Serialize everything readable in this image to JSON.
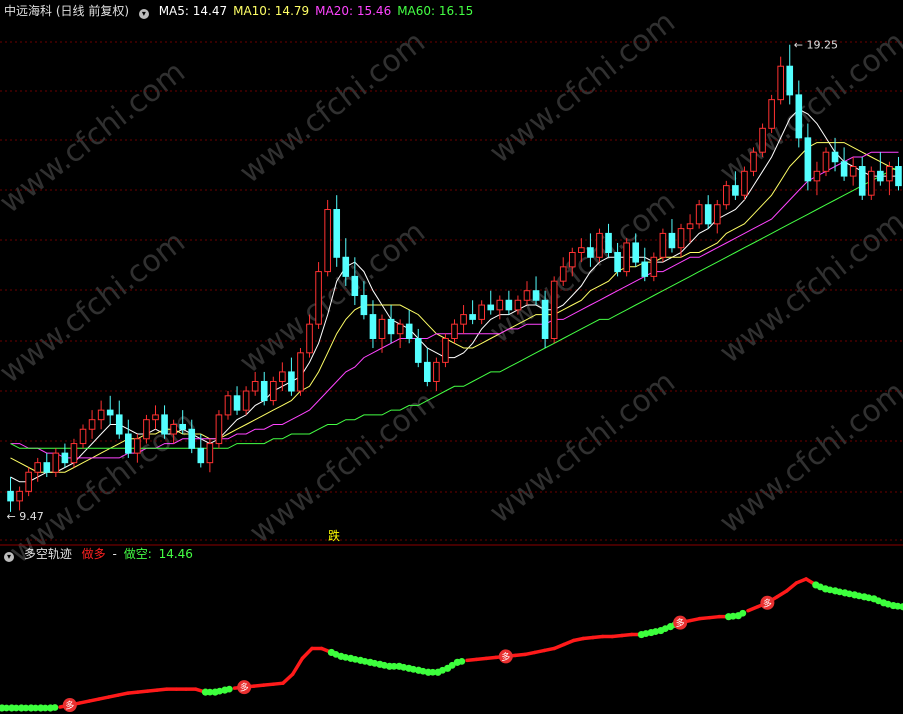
{
  "header": {
    "stock": "中远海科",
    "period": "(日线 前复权)",
    "ma": [
      {
        "label": "MA5",
        "value": "14.47",
        "color": "#ffffff"
      },
      {
        "label": "MA10",
        "value": "14.79",
        "color": "#ffff66"
      },
      {
        "label": "MA20",
        "value": "15.46",
        "color": "#ff44ff"
      },
      {
        "label": "MA60",
        "value": "16.15",
        "color": "#44ff44"
      }
    ]
  },
  "indicator": {
    "name": "多空轨迹",
    "long_label": "做多",
    "sep": "-",
    "short_label": "做空",
    "value": "14.46"
  },
  "watermark": "www.cfchi.com",
  "chart_data": [
    {
      "type": "candlestick",
      "panel": "price",
      "title": "中远海科 (日线 前复权)",
      "high_label": "19.25",
      "low_label": "9.47",
      "marker_label": "跌",
      "ylim": [
        9.3,
        19.6
      ],
      "ohlc": [
        [
          9.9,
          10.2,
          9.47,
          9.7
        ],
        [
          9.7,
          10.0,
          9.5,
          9.9
        ],
        [
          9.9,
          10.4,
          9.8,
          10.3
        ],
        [
          10.3,
          10.6,
          10.1,
          10.5
        ],
        [
          10.5,
          10.7,
          10.2,
          10.3
        ],
        [
          10.3,
          10.8,
          10.2,
          10.7
        ],
        [
          10.7,
          10.9,
          10.4,
          10.5
        ],
        [
          10.5,
          11.0,
          10.4,
          10.9
        ],
        [
          10.9,
          11.3,
          10.8,
          11.2
        ],
        [
          11.2,
          11.6,
          11.0,
          11.4
        ],
        [
          11.4,
          11.8,
          11.2,
          11.6
        ],
        [
          11.6,
          11.9,
          11.3,
          11.5
        ],
        [
          11.5,
          11.8,
          11.0,
          11.1
        ],
        [
          11.1,
          11.4,
          10.6,
          10.7
        ],
        [
          10.7,
          11.1,
          10.5,
          11.0
        ],
        [
          11.0,
          11.5,
          10.9,
          11.4
        ],
        [
          11.4,
          11.7,
          11.2,
          11.5
        ],
        [
          11.5,
          11.7,
          11.0,
          11.1
        ],
        [
          11.1,
          11.4,
          10.9,
          11.3
        ],
        [
          11.3,
          11.6,
          11.1,
          11.2
        ],
        [
          11.2,
          11.4,
          10.7,
          10.8
        ],
        [
          10.8,
          11.1,
          10.4,
          10.5
        ],
        [
          10.5,
          11.0,
          10.3,
          10.9
        ],
        [
          10.9,
          11.6,
          10.8,
          11.5
        ],
        [
          11.5,
          12.0,
          11.4,
          11.9
        ],
        [
          11.9,
          12.1,
          11.5,
          11.6
        ],
        [
          11.6,
          12.1,
          11.5,
          12.0
        ],
        [
          12.0,
          12.4,
          11.9,
          12.2
        ],
        [
          12.2,
          12.4,
          11.7,
          11.8
        ],
        [
          11.8,
          12.3,
          11.7,
          12.2
        ],
        [
          12.2,
          12.6,
          12.0,
          12.4
        ],
        [
          12.4,
          12.7,
          11.9,
          12.0
        ],
        [
          12.0,
          12.9,
          11.9,
          12.8
        ],
        [
          12.8,
          13.6,
          12.7,
          13.4
        ],
        [
          13.4,
          14.7,
          13.3,
          14.5
        ],
        [
          14.5,
          16.0,
          14.4,
          15.8
        ],
        [
          15.8,
          16.1,
          14.6,
          14.8
        ],
        [
          14.8,
          15.2,
          14.2,
          14.4
        ],
        [
          14.4,
          14.8,
          13.8,
          14.0
        ],
        [
          14.0,
          14.3,
          13.5,
          13.6
        ],
        [
          13.6,
          13.9,
          12.9,
          13.1
        ],
        [
          13.1,
          13.6,
          12.8,
          13.5
        ],
        [
          13.5,
          13.8,
          13.0,
          13.2
        ],
        [
          13.2,
          13.5,
          12.9,
          13.4
        ],
        [
          13.4,
          13.7,
          13.0,
          13.1
        ],
        [
          13.1,
          13.3,
          12.5,
          12.6
        ],
        [
          12.6,
          12.9,
          12.1,
          12.2
        ],
        [
          12.2,
          12.7,
          12.0,
          12.6
        ],
        [
          12.6,
          13.2,
          12.5,
          13.1
        ],
        [
          13.1,
          13.5,
          13.0,
          13.4
        ],
        [
          13.4,
          13.8,
          13.2,
          13.6
        ],
        [
          13.6,
          13.9,
          13.4,
          13.5
        ],
        [
          13.5,
          13.9,
          13.4,
          13.8
        ],
        [
          13.8,
          14.1,
          13.6,
          13.7
        ],
        [
          13.7,
          14.0,
          13.5,
          13.9
        ],
        [
          13.9,
          14.1,
          13.6,
          13.7
        ],
        [
          13.7,
          14.0,
          13.6,
          13.9
        ],
        [
          13.9,
          14.3,
          13.8,
          14.1
        ],
        [
          14.1,
          14.4,
          13.8,
          13.9
        ],
        [
          13.9,
          14.1,
          12.9,
          13.1
        ],
        [
          13.1,
          14.4,
          13.0,
          14.3
        ],
        [
          14.3,
          14.8,
          14.2,
          14.6
        ],
        [
          14.6,
          15.0,
          14.4,
          14.9
        ],
        [
          14.9,
          15.2,
          14.7,
          15.0
        ],
        [
          15.0,
          15.3,
          14.6,
          14.8
        ],
        [
          14.8,
          15.4,
          14.7,
          15.3
        ],
        [
          15.3,
          15.5,
          14.8,
          14.9
        ],
        [
          14.9,
          15.1,
          14.4,
          14.5
        ],
        [
          14.5,
          15.2,
          14.4,
          15.1
        ],
        [
          15.1,
          15.3,
          14.6,
          14.7
        ],
        [
          14.7,
          15.0,
          14.3,
          14.4
        ],
        [
          14.4,
          14.9,
          14.3,
          14.8
        ],
        [
          14.8,
          15.4,
          14.7,
          15.3
        ],
        [
          15.3,
          15.6,
          14.9,
          15.0
        ],
        [
          15.0,
          15.5,
          14.8,
          15.4
        ],
        [
          15.4,
          15.7,
          15.1,
          15.5
        ],
        [
          15.5,
          16.0,
          15.4,
          15.9
        ],
        [
          15.9,
          16.1,
          15.4,
          15.5
        ],
        [
          15.5,
          16.0,
          15.3,
          15.9
        ],
        [
          15.9,
          16.4,
          15.8,
          16.3
        ],
        [
          16.3,
          16.6,
          16.0,
          16.1
        ],
        [
          16.1,
          16.7,
          16.0,
          16.6
        ],
        [
          16.6,
          17.1,
          16.5,
          17.0
        ],
        [
          17.0,
          17.6,
          16.9,
          17.5
        ],
        [
          17.5,
          18.2,
          17.4,
          18.1
        ],
        [
          18.1,
          19.0,
          18.0,
          18.8
        ],
        [
          18.8,
          19.25,
          18.0,
          18.2
        ],
        [
          18.2,
          18.5,
          17.1,
          17.3
        ],
        [
          17.3,
          17.6,
          16.2,
          16.4
        ],
        [
          16.4,
          16.8,
          16.1,
          16.6
        ],
        [
          16.6,
          17.1,
          16.5,
          17.0
        ],
        [
          17.0,
          17.3,
          16.6,
          16.8
        ],
        [
          16.8,
          17.1,
          16.4,
          16.5
        ],
        [
          16.5,
          16.9,
          16.3,
          16.7
        ],
        [
          16.7,
          16.9,
          16.0,
          16.1
        ],
        [
          16.1,
          16.7,
          16.0,
          16.6
        ],
        [
          16.6,
          17.0,
          16.3,
          16.4
        ],
        [
          16.4,
          16.8,
          16.1,
          16.7
        ],
        [
          16.7,
          16.9,
          16.2,
          16.3
        ]
      ],
      "series": [
        {
          "name": "MA5",
          "values": [
            10.2,
            10.1,
            10.1,
            10.2,
            10.3,
            10.3,
            10.4,
            10.5,
            10.7,
            10.9,
            11.1,
            11.3,
            11.3,
            11.2,
            11.1,
            11.1,
            11.2,
            11.1,
            11.1,
            11.2,
            11.1,
            11.0,
            10.9,
            11.0,
            11.2,
            11.4,
            11.5,
            11.7,
            11.8,
            12.0,
            12.1,
            12.2,
            12.3,
            12.6,
            13.0,
            13.6,
            14.3,
            14.6,
            14.7,
            14.5,
            14.1,
            13.8,
            13.5,
            13.4,
            13.3,
            13.1,
            12.9,
            12.8,
            12.7,
            12.7,
            12.8,
            13.0,
            13.3,
            13.5,
            13.6,
            13.6,
            13.7,
            13.8,
            13.8,
            13.7,
            13.7,
            13.8,
            14.0,
            14.2,
            14.5,
            14.7,
            14.8,
            14.8,
            14.8,
            14.8,
            14.8,
            14.7,
            14.7,
            14.8,
            14.9,
            15.1,
            15.3,
            15.4,
            15.6,
            15.7,
            15.8,
            16.0,
            16.3,
            16.6,
            16.9,
            17.3,
            17.7,
            17.9,
            17.8,
            17.6,
            17.3,
            17.0,
            16.8,
            16.7,
            16.6,
            16.5,
            16.5,
            16.5,
            16.5
          ]
        },
        {
          "name": "MA10",
          "values": [
            10.6,
            10.5,
            10.4,
            10.3,
            10.3,
            10.3,
            10.3,
            10.4,
            10.5,
            10.6,
            10.7,
            10.8,
            10.9,
            11.0,
            11.0,
            11.1,
            11.1,
            11.2,
            11.2,
            11.1,
            11.1,
            11.1,
            11.0,
            11.0,
            11.1,
            11.2,
            11.3,
            11.4,
            11.5,
            11.6,
            11.7,
            11.8,
            12.0,
            12.1,
            12.4,
            12.8,
            13.2,
            13.5,
            13.7,
            13.8,
            13.8,
            13.8,
            13.8,
            13.8,
            13.7,
            13.6,
            13.4,
            13.2,
            13.1,
            13.0,
            12.9,
            12.9,
            13.0,
            13.1,
            13.2,
            13.3,
            13.4,
            13.5,
            13.6,
            13.6,
            13.6,
            13.7,
            13.8,
            13.9,
            14.1,
            14.2,
            14.3,
            14.5,
            14.6,
            14.6,
            14.7,
            14.7,
            14.8,
            14.8,
            14.8,
            14.9,
            14.9,
            15.0,
            15.1,
            15.3,
            15.4,
            15.5,
            15.7,
            15.9,
            16.1,
            16.4,
            16.7,
            16.9,
            17.1,
            17.2,
            17.2,
            17.2,
            17.2,
            17.1,
            17.0,
            16.9,
            16.8,
            16.7,
            16.6
          ]
        },
        {
          "name": "MA20",
          "values": [
            10.9,
            10.9,
            10.8,
            10.8,
            10.7,
            10.7,
            10.6,
            10.6,
            10.6,
            10.6,
            10.6,
            10.6,
            10.6,
            10.7,
            10.7,
            10.8,
            10.8,
            10.9,
            10.9,
            11.0,
            11.0,
            11.0,
            11.0,
            11.0,
            11.0,
            11.1,
            11.1,
            11.2,
            11.2,
            11.3,
            11.3,
            11.4,
            11.5,
            11.6,
            11.8,
            12.0,
            12.2,
            12.4,
            12.5,
            12.7,
            12.8,
            12.9,
            13.0,
            13.1,
            13.1,
            13.1,
            13.1,
            13.2,
            13.2,
            13.2,
            13.2,
            13.2,
            13.2,
            13.2,
            13.2,
            13.3,
            13.3,
            13.4,
            13.4,
            13.4,
            13.5,
            13.5,
            13.6,
            13.7,
            13.8,
            13.9,
            14.0,
            14.1,
            14.2,
            14.3,
            14.4,
            14.5,
            14.5,
            14.6,
            14.7,
            14.8,
            14.8,
            14.9,
            15.0,
            15.1,
            15.2,
            15.3,
            15.4,
            15.5,
            15.6,
            15.8,
            16.0,
            16.2,
            16.4,
            16.5,
            16.6,
            16.7,
            16.8,
            16.9,
            16.9,
            17.0,
            17.0,
            17.0,
            17.0
          ]
        },
        {
          "name": "MA60",
          "values": [
            10.9,
            10.8,
            10.8,
            10.8,
            10.8,
            10.8,
            10.8,
            10.8,
            10.8,
            10.8,
            10.8,
            10.8,
            10.8,
            10.8,
            10.8,
            10.8,
            10.8,
            10.8,
            10.8,
            10.8,
            10.8,
            10.8,
            10.8,
            10.8,
            10.8,
            10.9,
            10.9,
            10.9,
            10.9,
            11.0,
            11.0,
            11.1,
            11.1,
            11.1,
            11.2,
            11.3,
            11.3,
            11.4,
            11.4,
            11.5,
            11.5,
            11.5,
            11.6,
            11.6,
            11.7,
            11.7,
            11.8,
            11.9,
            12.0,
            12.1,
            12.1,
            12.2,
            12.3,
            12.4,
            12.4,
            12.5,
            12.6,
            12.7,
            12.8,
            12.9,
            13.0,
            13.1,
            13.2,
            13.3,
            13.4,
            13.5,
            13.5,
            13.6,
            13.7,
            13.8,
            13.9,
            14.0,
            14.1,
            14.2,
            14.3,
            14.4,
            14.5,
            14.6,
            14.7,
            14.8,
            14.9,
            15.0,
            15.1,
            15.2,
            15.3,
            15.4,
            15.5,
            15.6,
            15.7,
            15.8,
            15.9,
            16.0,
            16.1,
            16.2,
            16.3,
            16.4,
            16.5,
            16.6,
            16.7
          ]
        }
      ]
    },
    {
      "type": "line",
      "panel": "indicator",
      "name": "多空轨迹",
      "long_marker": "多",
      "ylim": [
        9.3,
        19.6
      ],
      "values": [
        9.3,
        9.3,
        9.3,
        9.3,
        9.3,
        9.3,
        9.35,
        9.45,
        9.55,
        9.65,
        9.75,
        9.85,
        9.95,
        10.05,
        10.1,
        10.15,
        10.2,
        10.25,
        10.25,
        10.25,
        10.25,
        10.1,
        10.1,
        10.2,
        10.3,
        10.35,
        10.4,
        10.45,
        10.5,
        10.55,
        11.0,
        11.8,
        12.3,
        12.3,
        12.1,
        11.9,
        11.8,
        11.7,
        11.6,
        11.5,
        11.4,
        11.4,
        11.3,
        11.2,
        11.1,
        11.1,
        11.3,
        11.6,
        11.7,
        11.75,
        11.8,
        11.85,
        11.9,
        11.95,
        12.0,
        12.1,
        12.2,
        12.3,
        12.5,
        12.7,
        12.8,
        12.85,
        12.9,
        12.9,
        12.95,
        13.0,
        13.0,
        13.1,
        13.2,
        13.4,
        13.6,
        13.7,
        13.8,
        13.85,
        13.9,
        13.9,
        13.95,
        14.2,
        14.4,
        14.6,
        14.9,
        15.2,
        15.6,
        15.8,
        15.5,
        15.3,
        15.2,
        15.1,
        15.0,
        14.9,
        14.8,
        14.6,
        14.46,
        14.4
      ],
      "state": [
        0,
        0,
        0,
        0,
        0,
        0,
        1,
        1,
        1,
        1,
        1,
        1,
        1,
        1,
        1,
        1,
        1,
        1,
        1,
        1,
        1,
        0,
        0,
        0,
        1,
        1,
        1,
        1,
        1,
        1,
        1,
        1,
        1,
        1,
        0,
        0,
        0,
        0,
        0,
        0,
        0,
        0,
        0,
        0,
        0,
        0,
        0,
        0,
        1,
        1,
        1,
        1,
        1,
        1,
        1,
        1,
        1,
        1,
        1,
        1,
        1,
        1,
        1,
        1,
        1,
        1,
        0,
        0,
        0,
        0,
        1,
        1,
        1,
        1,
        1,
        0,
        0,
        1,
        1,
        1,
        1,
        1,
        1,
        1,
        0,
        0,
        0,
        0,
        0,
        0,
        0,
        0,
        0,
        0
      ],
      "markers_at": [
        7,
        25,
        52,
        70,
        79
      ]
    }
  ]
}
